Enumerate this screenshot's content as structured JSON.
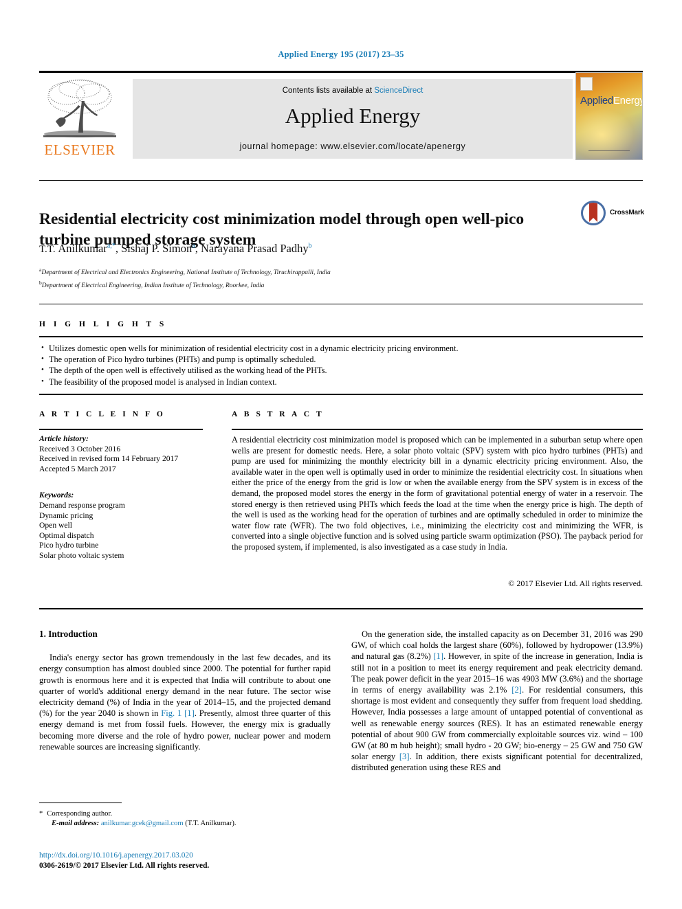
{
  "running_head": "Applied Energy 195 (2017) 23–35",
  "masthead": {
    "publisher": "ELSEVIER",
    "contents_prefix": "Contents lists available at ",
    "contents_link": "ScienceDirect",
    "journal_title": "Applied Energy",
    "homepage": "journal homepage: www.elsevier.com/locate/apenergy",
    "cover_brand_1": "Applied",
    "cover_brand_2": "Energy"
  },
  "article": {
    "title": "Residential electricity cost minimization model through open well-pico turbine pumped storage system",
    "crossmark_label": "CrossMark",
    "authors": [
      {
        "name": "T.T. Anilkumar",
        "sup": "a,*"
      },
      {
        "name": "Sishaj P. Simon",
        "sup": "a"
      },
      {
        "name": "Narayana Prasad Padhy",
        "sup": "b"
      }
    ],
    "affiliations": [
      {
        "sup": "a",
        "text": "Department of Electrical and Electronics Engineering, National Institute of Technology, Tiruchirappalli, India"
      },
      {
        "sup": "b",
        "text": "Department of Electrical Engineering, Indian Institute of Technology, Roorkee, India"
      }
    ]
  },
  "highlights": {
    "heading": "H I G H L I G H T S",
    "items": [
      "Utilizes domestic open wells for minimization of residential electricity cost in a dynamic electricity pricing environment.",
      "The operation of Pico hydro turbines (PHTs) and pump is optimally scheduled.",
      "The depth of the open well is effectively utilised as the working head of the PHTs.",
      "The feasibility of the proposed model is analysed in Indian context."
    ]
  },
  "article_info": {
    "heading": "A R T I C L E   I N F O",
    "history_label": "Article history:",
    "history": [
      "Received 3 October 2016",
      "Received in revised form 14 February 2017",
      "Accepted 5 March 2017"
    ],
    "keywords_label": "Keywords:",
    "keywords": [
      "Demand response program",
      "Dynamic pricing",
      "Open well",
      "Optimal dispatch",
      "Pico hydro turbine",
      "Solar photo voltaic system"
    ]
  },
  "abstract": {
    "heading": "A B S T R A C T",
    "text": "A residential electricity cost minimization model is proposed which can be implemented in a suburban setup where open wells are present for domestic needs. Here, a solar photo voltaic (SPV) system with pico hydro turbines (PHTs) and pump are used for minimizing the monthly electricity bill in a dynamic electricity pricing environment. Also, the available water in the open well is optimally used in order to minimize the residential electricity cost. In situations when either the price of the energy from the grid is low or when the available energy from the SPV system is in excess of the demand, the proposed model stores the energy in the form of gravitational potential energy of water in a reservoir. The stored energy is then retrieved using PHTs which feeds the load at the time when the energy price is high. The depth of the well is used as the working head for the operation of turbines and are optimally scheduled in order to minimize the water flow rate (WFR). The two fold objectives, i.e., minimizing the electricity cost and minimizing the WFR, is converted into a single objective function and is solved using particle swarm optimization (PSO). The payback period for the proposed system, if implemented, is also investigated as a case study in India.",
    "copyright": "© 2017 Elsevier Ltd. All rights reserved."
  },
  "introduction": {
    "section_title": "1. Introduction",
    "left_p1_a": "India's energy sector has grown tremendously in the last few decades, and its energy consumption has almost doubled since 2000. The potential for further rapid growth is enormous here and it is expected that India will contribute to about one quarter of world's additional energy demand in the near future. The sector wise electricity demand (%) of India in the year of 2014–15, and the projected demand (%) for the year 2040 is shown in ",
    "left_p1_ref": "Fig. 1 [1]",
    "left_p1_b": ". Presently, almost three quarter of this energy demand is met from fossil fuels. However, the energy mix is gradually becoming more diverse and the role of hydro power, nuclear power and modern renewable sources are increasing significantly.",
    "right_p1_a": "On the generation side, the installed capacity as on December 31, 2016 was 290 GW, of which coal holds the largest share (60%), followed by hydropower (13.9%) and natural gas (8.2%) ",
    "right_p1_ref1": "[1]",
    "right_p1_b": ". However, in spite of the increase in generation, India is still not in a position to meet its energy requirement and peak electricity demand. The peak power deficit in the year 2015–16 was 4903 MW (3.6%) and the shortage in terms of energy availability was 2.1% ",
    "right_p1_ref2": "[2]",
    "right_p1_c": ". For residential consumers, this shortage is most evident and consequently they suffer from frequent load shedding. However, India possesses a large amount of untapped potential of conventional as well as renewable energy sources (RES). It has an estimated renewable energy potential of about 900 GW from commercially exploitable sources viz. wind – 100 GW (at 80 m hub height); small hydro - 20 GW; bio-energy – 25 GW and 750 GW solar energy ",
    "right_p1_ref3": "[3]",
    "right_p1_d": ". In addition, there exists significant potential for decentralized, distributed generation using these RES and"
  },
  "footer": {
    "corresponding_marker": "*",
    "corresponding_label": "Corresponding author.",
    "email_label": "E-mail address:",
    "email": "anilkumar.gcek@gmail.com",
    "email_owner": "(T.T. Anilkumar).",
    "doi": "http://dx.doi.org/10.1016/j.apenergy.2017.03.020",
    "issn_line": "0306-2619/© 2017 Elsevier Ltd. All rights reserved."
  },
  "colors": {
    "link": "#1a7db6",
    "elsevier_orange": "#ea7b22",
    "banner_gray": "#e5e5e5"
  }
}
